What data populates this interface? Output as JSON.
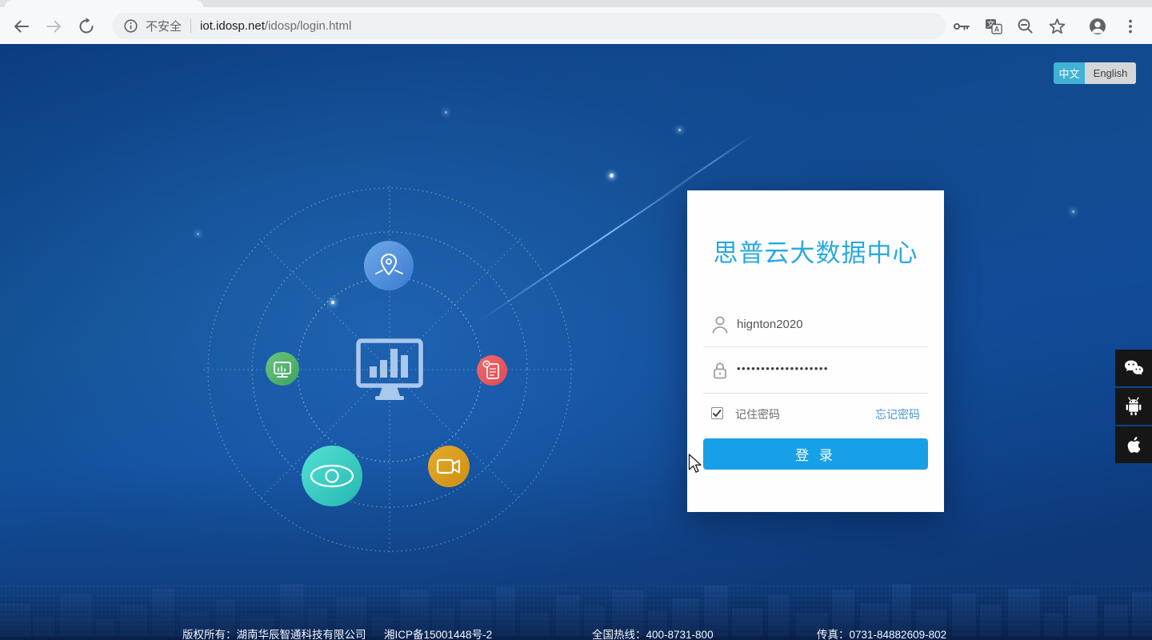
{
  "browser": {
    "security_label": "不安全",
    "url_host": "iot.idosp.net",
    "url_path": "/idosp/login.html"
  },
  "language_toggle": {
    "chinese_label": "中文",
    "english_label": "English",
    "active": "中文",
    "active_bg": "#41b2d5"
  },
  "login_card": {
    "title": "思普云大数据中心",
    "title_color": "#29a9e0",
    "username_value": "hignton2020",
    "password_mask": "•••••••••••••••••••",
    "remember_label": "记住密码",
    "remember_checked": true,
    "forgot_link": "忘记密码",
    "login_button_label": "登 录",
    "button_color": "#17a0e6"
  },
  "footer": {
    "copyright": "版权所有：湖南华辰智通科技有限公司",
    "icp": "湘ICP备15001448号-2",
    "hotline": "全国热线：400-8731-800",
    "fax": "传真：0731-84882609-802"
  },
  "icons": {
    "translate_primary": "文",
    "translate_secondary": "A",
    "toolbar": [
      "back-icon",
      "forward-icon",
      "reload-icon",
      "info-icon",
      "key-icon",
      "translate-icon",
      "zoom-out-icon",
      "star-icon",
      "avatar-icon",
      "menu-dots-icon"
    ],
    "social": [
      "wechat-icon",
      "android-icon",
      "apple-icon"
    ],
    "diagram_center": "dashboard-monitor-icon",
    "diagram_satellites": [
      "map-location-icon",
      "device-monitor-icon",
      "report-document-icon",
      "eye-monitoring-icon",
      "video-camera-icon"
    ]
  },
  "diagram_colors": {
    "satellite_blue": "#4a8fd8",
    "satellite_green": "#4eb563",
    "satellite_red": "#e9565c",
    "satellite_teal": "#3bcdc3",
    "satellite_orange": "#dda11d",
    "center_icon": "#aac7ec"
  }
}
